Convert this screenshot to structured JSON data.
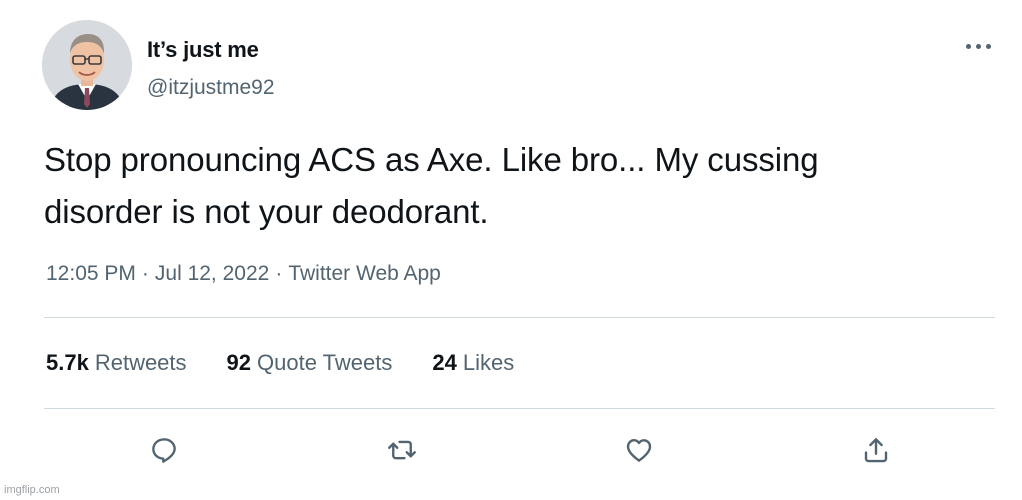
{
  "user": {
    "display_name": "It’s just me",
    "handle": "@itzjustme92"
  },
  "tweet": {
    "text_lines": [
      "Stop pronouncing ACS as Axe. Like bro... My cussing",
      "disorder is not your deodorant."
    ],
    "time": "12:05 PM",
    "date": "Jul 12, 2022",
    "source": "Twitter Web App",
    "separator": "·"
  },
  "stats": {
    "retweets": {
      "count": "5.7k",
      "label": "Retweets"
    },
    "quotes": {
      "count": "92",
      "label": "Quote Tweets"
    },
    "likes": {
      "count": "24",
      "label": "Likes"
    }
  },
  "icons": {
    "reply": "reply-icon",
    "retweet": "retweet-icon",
    "like": "heart-icon",
    "share": "share-icon",
    "more": "more-icon"
  },
  "colors": {
    "text": "#0f1419",
    "secondary": "#536471",
    "divider": "#cfd9de"
  },
  "watermark": "imgflip.com"
}
